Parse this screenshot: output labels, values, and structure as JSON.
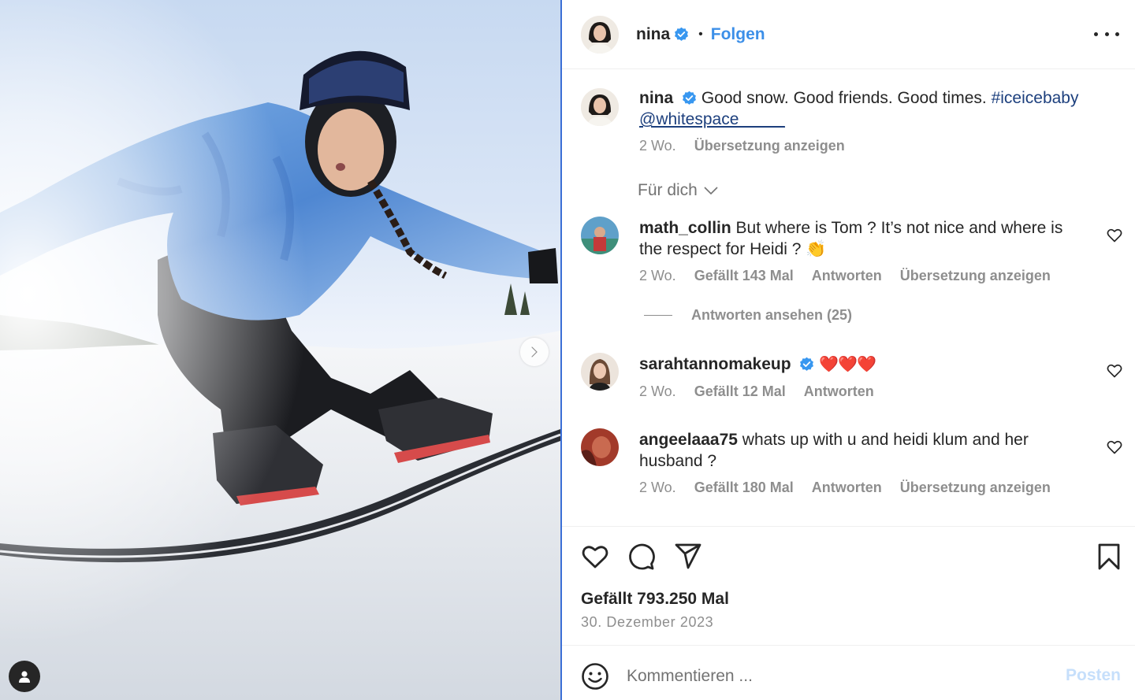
{
  "post": {
    "author": "nina",
    "follow_label": "Folgen",
    "dot": "•",
    "more_icon": "more-horizontal-icon",
    "photo_alt": "Snowboarder in blauer Daunenjacke auf der Piste",
    "next_icon": "chevron-right-icon",
    "tag_icon": "user-tag-icon"
  },
  "caption": {
    "user": "nina",
    "text": "Good snow. Good friends. Good times.",
    "hashtag": "#iceicebaby",
    "mention": "@whitespace_____",
    "age": "2 Wo.",
    "translate": "Übersetzung anzeigen"
  },
  "sort": {
    "label": "Für dich"
  },
  "comments": [
    {
      "user": "math_collin",
      "text": "But where is Tom ? It’s not nice and where is the respect for Heidi ? 👏",
      "age": "2 Wo.",
      "likes": "Gefällt 143 Mal",
      "reply": "Antworten",
      "translate": "Übersetzung anzeigen"
    },
    {
      "user": "sarahtannomakeup",
      "text": "❤️❤️❤️",
      "age": "2 Wo.",
      "likes": "Gefällt 12 Mal",
      "reply": "Antworten"
    },
    {
      "user": "angeelaaa75",
      "text": "whats up with u and heidi klum and her husband ?",
      "age": "2 Wo.",
      "likes": "Gefällt 180 Mal",
      "reply": "Antworten",
      "translate": "Übersetzung anzeigen"
    }
  ],
  "view_replies": "Antworten ansehen (25)",
  "footer": {
    "likes": "Gefällt 793.250 Mal",
    "date": "30. Dezember 2023",
    "comment_placeholder": "Kommentieren ...",
    "post_label": "Posten"
  },
  "colors": {
    "link_blue": "#3c8fe8",
    "hashtag_blue": "#1c3f7d",
    "muted": "#8e8e8e",
    "post_disabled": "#c6dffb",
    "heart_red": "#ed2a3a"
  }
}
